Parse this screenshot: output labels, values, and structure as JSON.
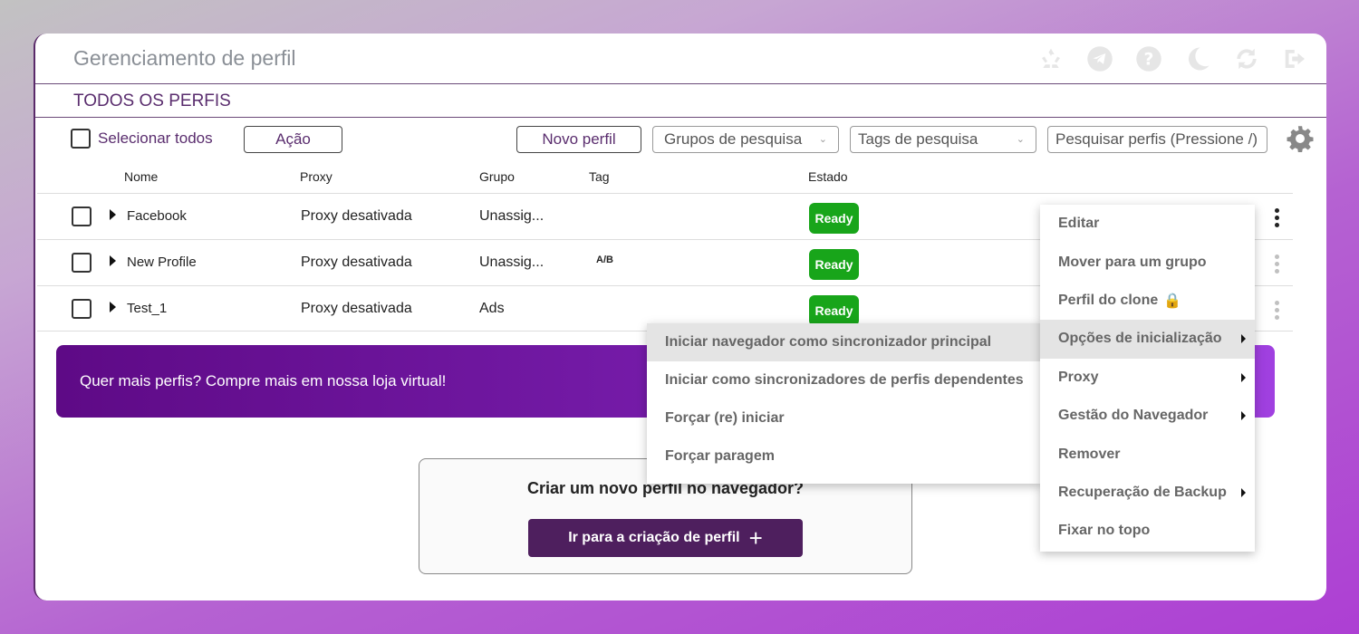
{
  "app": {
    "title": "Gerenciamento de perfil"
  },
  "header_icons": [
    "recycle-icon",
    "telegram-icon",
    "help-icon",
    "moon-icon",
    "refresh-icon",
    "logout-icon"
  ],
  "section": {
    "title": "TODOS OS PERFIS"
  },
  "toolbar": {
    "select_all": "Selecionar todos",
    "action": "Ação",
    "new_profile": "Novo perfil",
    "group_search": "Grupos de pesquisa",
    "tag_search": "Tags de pesquisa",
    "search_placeholder": "Pesquisar perfis (Pressione /)"
  },
  "columns": {
    "name": "Nome",
    "proxy": "Proxy",
    "group": "Grupo",
    "tag": "Tag",
    "status": "Estado"
  },
  "profiles": [
    {
      "name": "Facebook",
      "proxy": "Proxy desativada",
      "group": "Unassig...",
      "tag": "",
      "status": "Ready"
    },
    {
      "name": "New Profile",
      "proxy": "Proxy desativada",
      "group": "Unassig...",
      "tag": "A/B",
      "status": "Ready"
    },
    {
      "name": "Test_1",
      "proxy": "Proxy desativada",
      "group": "Ads",
      "tag": "",
      "status": "Ready"
    }
  ],
  "promo": {
    "text": "Quer mais perfis? Compre mais em nossa loja virtual!"
  },
  "create": {
    "title": "Criar um novo perfil no navegador?",
    "button": "Ir para a criação de perfil"
  },
  "context_menu": {
    "items": [
      {
        "label": "Editar",
        "has_submenu": false
      },
      {
        "label": "Mover para um grupo",
        "has_submenu": false
      },
      {
        "label": "Perfil do clone",
        "has_submenu": false
      },
      {
        "label": "Opções de inicialização",
        "has_submenu": true
      },
      {
        "label": "Proxy",
        "has_submenu": true
      },
      {
        "label": "Gestão do Navegador",
        "has_submenu": true
      },
      {
        "label": "Remover",
        "has_submenu": false
      },
      {
        "label": "Recuperação de Backup",
        "has_submenu": true
      },
      {
        "label": "Fixar no topo",
        "has_submenu": false
      }
    ]
  },
  "submenu": {
    "items": [
      "Iniciar navegador como sincronizador principal",
      "Iniciar como sincronizadores de perfis dependentes",
      "Forçar (re) iniciar",
      "Forçar paragem"
    ]
  },
  "colors": {
    "accent": "#5a2d6e",
    "ready": "#18a51a",
    "promo": "#7a1fb0"
  }
}
